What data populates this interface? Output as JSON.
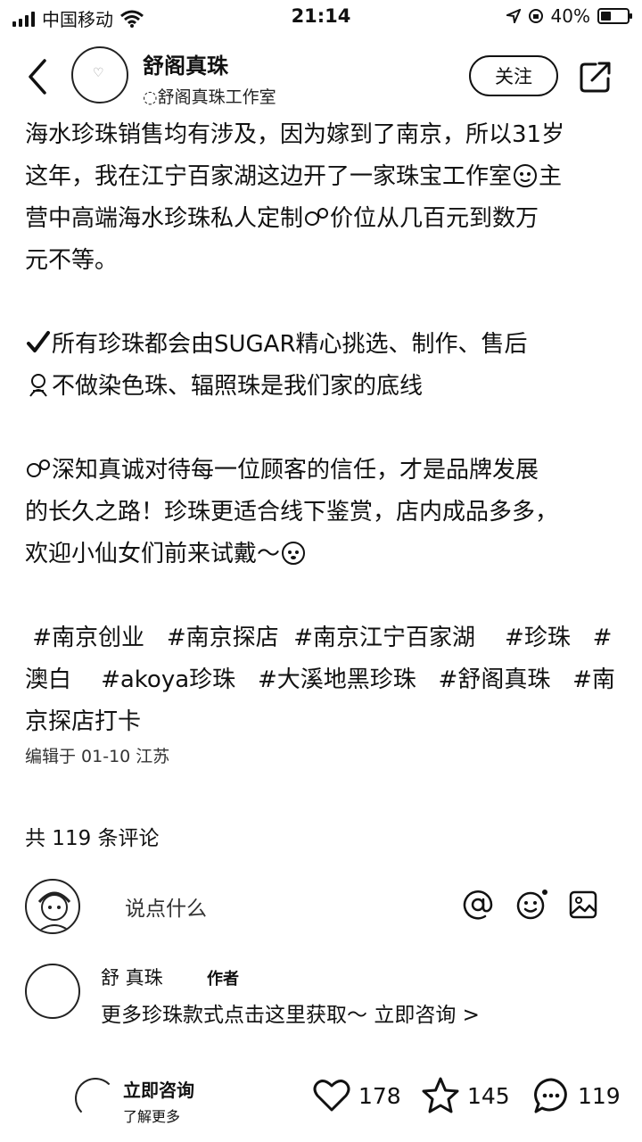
{
  "status_bar": {
    "carrier": "中国移动",
    "time": "21:14",
    "battery": "40%",
    "battery_level": 0.4
  },
  "header": {
    "author_name": "舒阁真珠",
    "subtitle": "◌舒阁真珠工作室",
    "follow_label": "关注"
  },
  "post": {
    "paragraphs": [
      [
        "海水珍珠销售均有涉及，因为嫁到了南京，所以31岁",
        "这年，我在江宁百家湖这边开了一家珠宝工作室",
        "主",
        "营中高端海水珍珠私人定制",
        "价位从几百元到数万",
        "元不等。"
      ],
      [
        "所有珍珠都会由SUGAR精心挑选、制作、售后",
        "不做染色珠、辐照珠是我们家的底线"
      ],
      [
        "深知真诚对待每一位顾客的信任，才是品牌发展",
        "的长久之路！珍珠更适合线下鉴赏，店内成品多多，",
        "欢迎小仙女们前来试戴～"
      ]
    ],
    "tags": [
      "#南京创业",
      "#南京探店",
      "#南京江宁百家湖",
      "#珍珠",
      "#",
      "澳白",
      "#akoya珍珠",
      "#大溪地黑珍珠",
      "#舒阁真珠",
      "#南",
      "京探店打卡"
    ],
    "edit_info": "编辑于 01-10 江苏"
  },
  "comments": {
    "count_label": "共 119 条评论",
    "input_placeholder": "说点什么",
    "reply": {
      "name": "舒  真珠",
      "badge": "作者",
      "text": "更多珍珠款式点击这里获取～",
      "link": "立即咨询 >"
    }
  },
  "bottom_bar": {
    "consult_label": "立即咨询",
    "more_label": "了解更多",
    "likes": "178",
    "stars": "145",
    "comments": "119"
  },
  "icons": {
    "back": "chevron-left-icon",
    "share": "share-icon",
    "mention": "at-icon",
    "emoji": "smile-icon",
    "image": "image-icon",
    "like": "heart-icon",
    "collect": "star-icon",
    "comment": "comment-icon"
  }
}
